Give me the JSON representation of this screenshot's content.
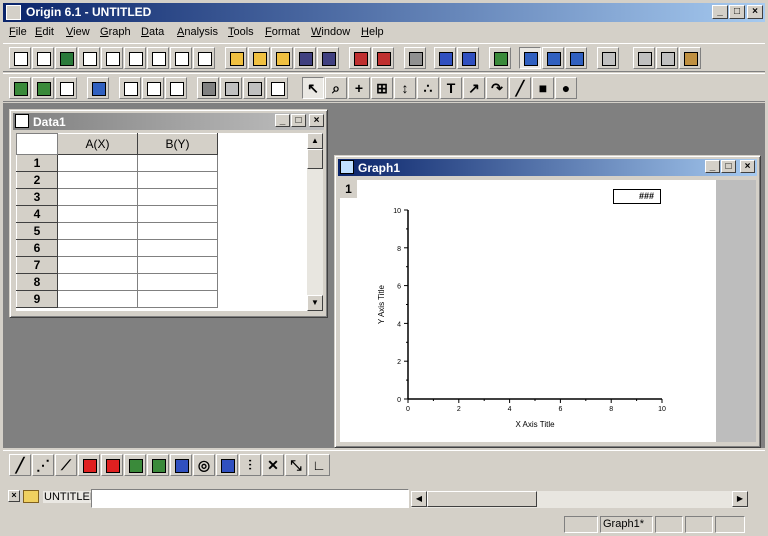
{
  "app": {
    "title": "Origin 6.1 - UNTITLED"
  },
  "menu": [
    "File",
    "Edit",
    "View",
    "Graph",
    "Data",
    "Analysis",
    "Tools",
    "Format",
    "Window",
    "Help"
  ],
  "worksheet": {
    "title": "Data1",
    "columns": [
      "A(X)",
      "B(Y)"
    ],
    "rows": [
      "1",
      "2",
      "3",
      "4",
      "5",
      "6",
      "7",
      "8",
      "9"
    ]
  },
  "graph": {
    "title": "Graph1",
    "layer": "1",
    "legend": "###",
    "xlabel": "X Axis Title",
    "ylabel": "Y Axis Title"
  },
  "chart_data": {
    "type": "scatter",
    "title": "",
    "xlabel": "X Axis Title",
    "ylabel": "Y Axis Title",
    "xlim": [
      0,
      10
    ],
    "ylim": [
      0,
      10
    ],
    "xticks": [
      0,
      2,
      4,
      6,
      8,
      10
    ],
    "yticks": [
      0,
      2,
      4,
      6,
      8,
      10
    ],
    "series": [],
    "legend": "###",
    "grid": false
  },
  "project": {
    "folder": "UNTITLED"
  },
  "status": {
    "active_window": "Graph1*"
  }
}
